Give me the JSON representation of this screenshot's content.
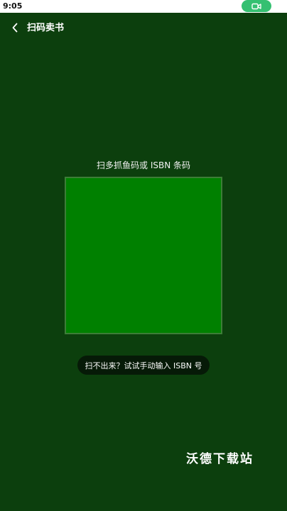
{
  "status_bar": {
    "time": "9:05",
    "record_icon": "video-camera-icon"
  },
  "header": {
    "back_icon": "chevron-left-icon",
    "title": "扫码卖书"
  },
  "scanner": {
    "hint": "扫多抓鱼码或 ISBN 条码",
    "frame_color": "#008000"
  },
  "manual_entry": {
    "label": "扫不出来？试试手动输入 ISBN 号"
  },
  "watermark": {
    "text": "沃德下载站"
  },
  "colors": {
    "background": "#0c3f0d",
    "record_pill": "#35c071",
    "pill_background": "#061a07"
  }
}
